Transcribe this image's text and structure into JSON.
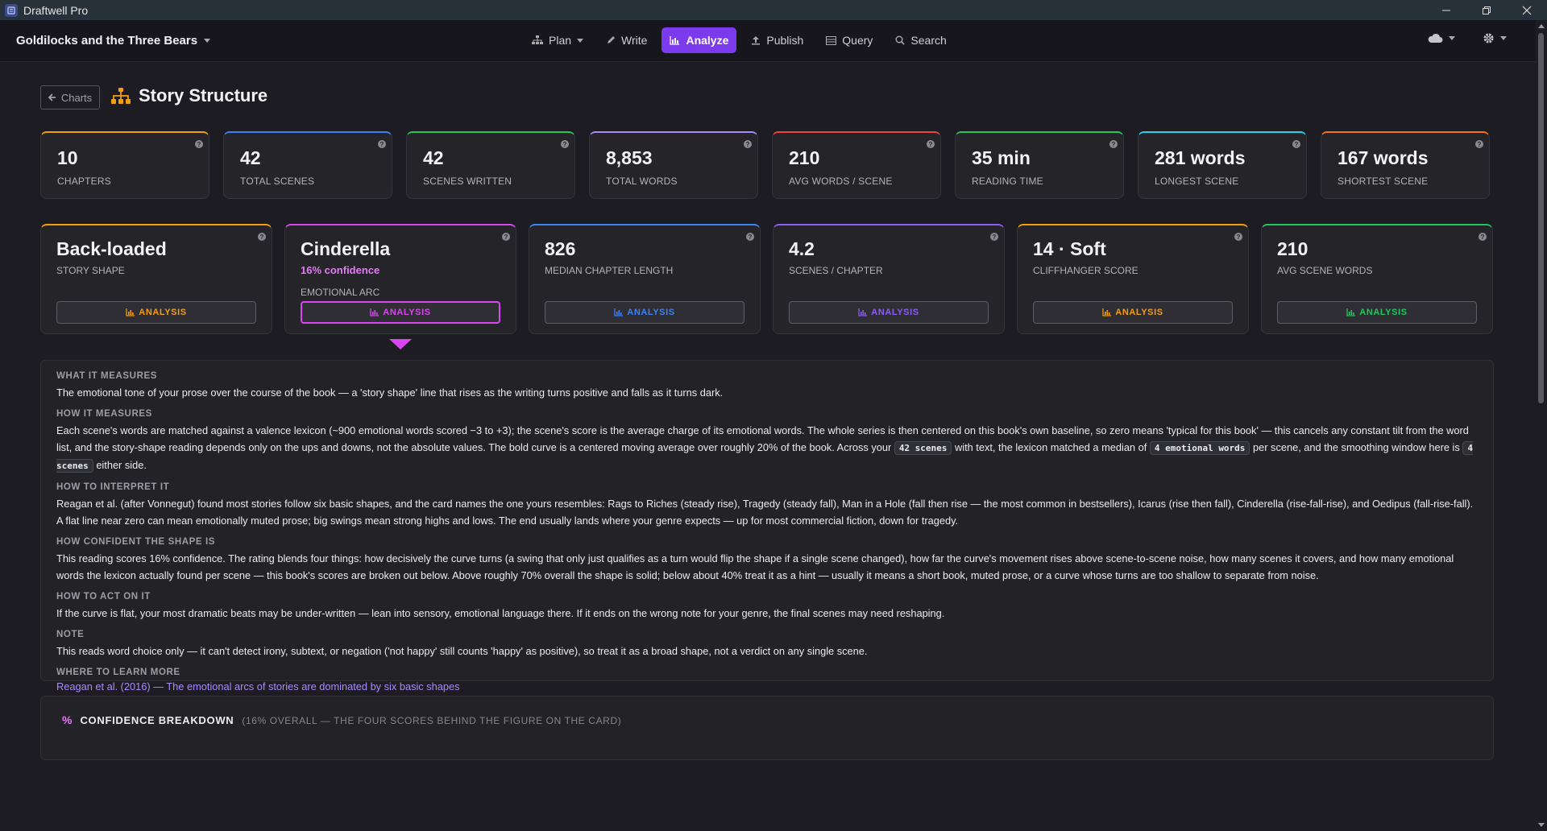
{
  "window": {
    "title": "Draftwell Pro"
  },
  "nav": {
    "project": "Goldilocks and the Three Bears",
    "items": [
      {
        "label": "Plan",
        "icon": "sitemap-icon"
      },
      {
        "label": "Write",
        "icon": "pencil-icon"
      },
      {
        "label": "Analyze",
        "icon": "bar-chart-icon",
        "active": true
      },
      {
        "label": "Publish",
        "icon": "upload-icon"
      },
      {
        "label": "Query",
        "icon": "table-icon"
      },
      {
        "label": "Search",
        "icon": "search-icon"
      }
    ]
  },
  "page": {
    "back_label": "Charts",
    "title": "Story Structure"
  },
  "stats": [
    {
      "value": "10",
      "label": "CHAPTERS",
      "color": "#f59e0b"
    },
    {
      "value": "42",
      "label": "TOTAL SCENES",
      "color": "#3b82f6"
    },
    {
      "value": "42",
      "label": "SCENES WRITTEN",
      "color": "#22c55e"
    },
    {
      "value": "8,853",
      "label": "TOTAL WORDS",
      "color": "#a78bfa"
    },
    {
      "value": "210",
      "label": "AVG WORDS / SCENE",
      "color": "#ef4444"
    },
    {
      "value": "35 min",
      "label": "READING TIME",
      "color": "#22c55e"
    },
    {
      "value": "281 words",
      "label": "LONGEST SCENE",
      "color": "#22d3ee"
    },
    {
      "value": "167 words",
      "label": "SHORTEST SCENE",
      "color": "#f97316"
    }
  ],
  "analysis_button_label": "ANALYSIS",
  "analysis_cards": [
    {
      "value": "Back-loaded",
      "label": "STORY SHAPE",
      "color": "#f59e0b"
    },
    {
      "value": "Cinderella",
      "confidence": "16% confidence",
      "label": "EMOTIONAL ARC",
      "color": "#d946ef"
    },
    {
      "value": "826",
      "label": "MEDIAN CHAPTER LENGTH",
      "color": "#3b82f6"
    },
    {
      "value": "4.2",
      "label": "SCENES / CHAPTER",
      "color": "#8b5cf6"
    },
    {
      "value": "14 · Soft",
      "label": "CLIFFHANGER SCORE",
      "color": "#f59e0b"
    },
    {
      "value": "210",
      "label": "AVG SCENE WORDS",
      "color": "#22c55e"
    }
  ],
  "explanation": {
    "what_heading": "WHAT IT MEASURES",
    "what_text": "The emotional tone of your prose over the course of the book — a 'story shape' line that rises as the writing turns positive and falls as it turns dark.",
    "how_heading": "HOW IT MEASURES",
    "how_text_1": "Each scene's words are matched against a valence lexicon (~900 emotional words scored −3 to +3); the scene's score is the average charge of its emotional words. The whole series is then centered on this book's own baseline, so zero means 'typical for this book' — this cancels any constant tilt from the word list, and the story-shape reading depends only on the ups and downs, not the absolute values. The bold curve is a centered moving average over roughly 20% of the book. Across your",
    "how_chip_1": "42 scenes",
    "how_text_2": "with text, the lexicon matched a median of",
    "how_chip_2": "4 emotional words",
    "how_text_3": "per scene, and the smoothing window here is",
    "how_chip_3": "4 scenes",
    "how_text_4": "either side.",
    "interpret_heading": "HOW TO INTERPRET IT",
    "interpret_text": "Reagan et al. (after Vonnegut) found most stories follow six basic shapes, and the card names the one yours resembles: Rags to Riches (steady rise), Tragedy (steady fall), Man in a Hole (fall then rise — the most common in bestsellers), Icarus (rise then fall), Cinderella (rise-fall-rise), and Oedipus (fall-rise-fall). A flat line near zero can mean emotionally muted prose; big swings mean strong highs and lows. The end usually lands where your genre expects — up for most commercial fiction, down for tragedy.",
    "confident_heading": "HOW CONFIDENT THE SHAPE IS",
    "confident_text": "This reading scores 16% confidence. The rating blends four things: how decisively the curve turns (a swing that only just qualifies as a turn would flip the shape if a single scene changed), how far the curve's movement rises above scene-to-scene noise, how many scenes it covers, and how many emotional words the lexicon actually found per scene — this book's scores are broken out below. Above roughly 70% overall the shape is solid; below about 40% treat it as a hint — usually it means a short book, muted prose, or a curve whose turns are too shallow to separate from noise.",
    "act_heading": "HOW TO ACT ON IT",
    "act_text": "If the curve is flat, your most dramatic beats may be under-written — lean into sensory, emotional language there. If it ends on the wrong note for your genre, the final scenes may need reshaping.",
    "note_heading": "NOTE",
    "note_text": "This reads word choice only — it can't detect irony, subtext, or negation ('not happy' still counts 'happy' as positive), so treat it as a broad shape, not a verdict on any single scene.",
    "learn_heading": "WHERE TO LEARN MORE",
    "learn_link": "Reagan et al. (2016) — The emotional arcs of stories are dominated by six basic shapes"
  },
  "confidence": {
    "icon": "percent-icon",
    "title": "CONFIDENCE BREAKDOWN",
    "subtitle": "(16% OVERALL — THE FOUR SCORES BEHIND THE FIGURE ON THE CARD)"
  }
}
